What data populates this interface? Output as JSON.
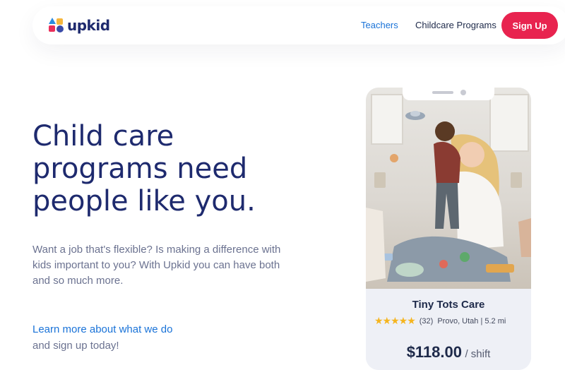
{
  "header": {
    "logo_text": "upkid",
    "nav": {
      "teachers": "Teachers",
      "programs": "Childcare Programs"
    },
    "signup_label": "Sign Up"
  },
  "hero": {
    "title_lines": [
      "Child care",
      "programs need",
      "people like you."
    ],
    "desc_lines": [
      "Want a job that's flexible? Is making a difference with",
      "kids important to you? With Upkid you can have both",
      "and so much more."
    ],
    "link_text": "Learn more about what we do",
    "after_link": "and sign up today!"
  },
  "card": {
    "name": "Tiny Tots Care",
    "stars": "★★★★★",
    "rating_count": "(32)",
    "location": "Provo, Utah | 5.2 mi",
    "price": "$118.00",
    "per": "/ shift"
  },
  "colors": {
    "brand_navy": "#1e2a6e",
    "link_blue": "#1a73d8",
    "signup_red": "#e8234f",
    "star_gold": "#f5b51f"
  }
}
